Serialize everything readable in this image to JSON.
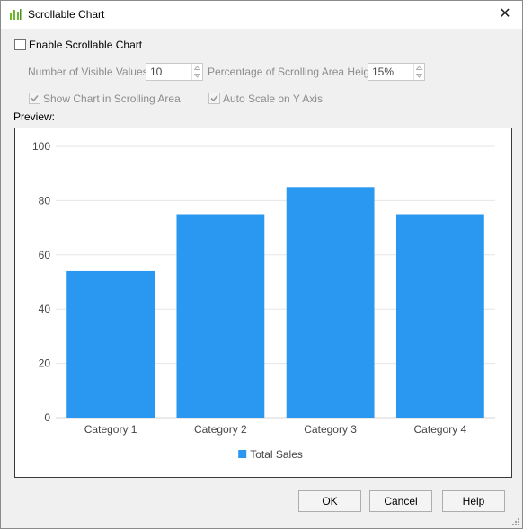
{
  "window": {
    "title": "Scrollable Chart",
    "close_glyph": "✕"
  },
  "options": {
    "enable_label": "Enable Scrollable Chart",
    "enable_checked": false,
    "visible_values_label": "Number of Visible Values:",
    "visible_values": "10",
    "scroll_height_label": "Percentage of Scrolling Area Height:",
    "scroll_height": "15%",
    "show_chart_label": "Show Chart in Scrolling Area",
    "show_chart_checked": true,
    "auto_scale_label": "Auto Scale on Y Axis",
    "auto_scale_checked": true
  },
  "preview_label": "Preview:",
  "buttons": {
    "ok": "OK",
    "cancel": "Cancel",
    "help": "Help"
  },
  "colors": {
    "bar": "#2a98f0",
    "grid": "#e6e6e6",
    "axis_text": "#444444",
    "icon_green": "#6bb82e"
  },
  "chart_data": {
    "type": "bar",
    "categories": [
      "Category 1",
      "Category 2",
      "Category 3",
      "Category 4"
    ],
    "series": [
      {
        "name": "Total Sales",
        "values": [
          54,
          75,
          85,
          75
        ]
      }
    ],
    "ylim": [
      0,
      100
    ],
    "yticks": [
      0,
      20,
      40,
      60,
      80,
      100
    ],
    "grid": true,
    "legend": "bottom-center",
    "title": "",
    "xlabel": "",
    "ylabel": ""
  }
}
